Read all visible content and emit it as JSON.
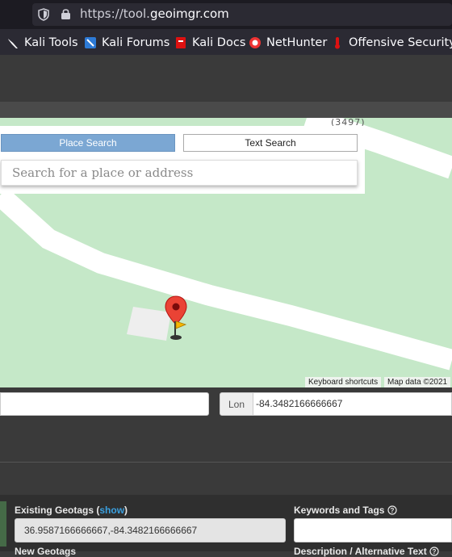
{
  "browser": {
    "url_prefix": "https://tool.",
    "url_host": "geoimgr.com",
    "bookmarks": [
      {
        "label": "Kali Tools",
        "icon": "kali-dragon-icon"
      },
      {
        "label": "Kali Forums",
        "icon": "kali-forums-icon"
      },
      {
        "label": "Kali Docs",
        "icon": "kali-docs-icon"
      },
      {
        "label": "NetHunter",
        "icon": "nethunter-icon"
      },
      {
        "label": "Offensive Security",
        "icon": "offsec-icon"
      }
    ]
  },
  "map": {
    "road_label": "(3497)",
    "tabs": {
      "place": "Place Search",
      "text": "Text Search"
    },
    "search_placeholder": "Search for a place or address",
    "footer_shortcuts": "Keyboard shortcuts",
    "footer_attribution": "Map data ©2021"
  },
  "coords": {
    "lon_label": "Lon",
    "lon_value": "-84.3482166666667"
  },
  "form": {
    "existing_label": "Existing Geotags (",
    "existing_show": "show",
    "existing_close": ")",
    "existing_value": "36.9587166666667,-84.3482166666667",
    "keywords_label": "Keywords and Tags",
    "new_geotags_label": "New Geotags",
    "description_label": "Description / Alternative Text"
  },
  "colors": {
    "accent_blue": "#7ba7d3",
    "map_green": "#c5e8c8",
    "marker_red": "#ea4335",
    "link_blue": "#3aa0e0"
  }
}
